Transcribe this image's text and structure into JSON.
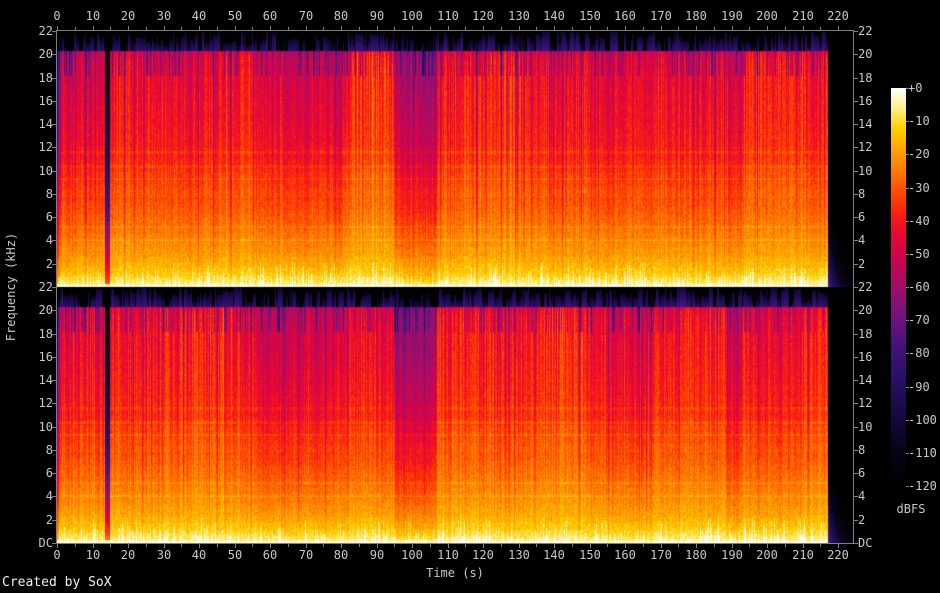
{
  "credit": "Created by SoX",
  "colors": {
    "background": "#000000",
    "label_text": "#c8c8c8",
    "credit_text": "#f0f0f0",
    "axis_line": "#808080"
  },
  "axes": {
    "time": {
      "label": "Time (s)",
      "tick_values": [
        0,
        10,
        20,
        30,
        40,
        50,
        60,
        70,
        80,
        90,
        100,
        110,
        120,
        130,
        140,
        150,
        160,
        170,
        180,
        190,
        200,
        210,
        220
      ],
      "tick_labels": [
        "0",
        "10",
        "20",
        "30",
        "40",
        "50",
        "60",
        "70",
        "80",
        "90",
        "100",
        "110",
        "120",
        "130",
        "140",
        "150",
        "160",
        "170",
        "180",
        "190",
        "200",
        "210",
        "220"
      ]
    },
    "frequency": {
      "label": "Frequency (kHz)",
      "tick_values": [
        22,
        20,
        18,
        16,
        14,
        12,
        10,
        8,
        6,
        4,
        2
      ],
      "tick_labels": [
        "22",
        "20",
        "18",
        "16",
        "14",
        "12",
        "10",
        "8",
        "6",
        "4",
        "2"
      ],
      "dc_label": "DC"
    }
  },
  "colorbar": {
    "unit_label": "dBFS",
    "tick_labels": [
      "+0",
      "-10",
      "-20",
      "-30",
      "-40",
      "-50",
      "-60",
      "-70",
      "-80",
      "-90",
      "-100",
      "-110",
      "-120"
    ]
  },
  "chart_data": {
    "type": "heatmap",
    "subtype": "audio-spectrogram",
    "title": "",
    "xlabel": "Time (s)",
    "ylabel": "Frequency (kHz)",
    "zlabel": "dBFS",
    "channels": 2,
    "x_range_s": [
      0,
      224.3
    ],
    "y_range_khz": [
      0,
      22
    ],
    "z_range_dbfs": [
      -120,
      0
    ],
    "audio_end_s": 217,
    "lowpass_cutoff_khz": 20.35,
    "silence_gap_s": [
      13.4,
      14.7
    ],
    "loudness_sections": [
      {
        "t0": 0,
        "t1": 13.4,
        "level": 0.94
      },
      {
        "t0": 13.4,
        "t1": 14.7,
        "level": 0.22
      },
      {
        "t0": 14.7,
        "t1": 56,
        "level": 1.0
      },
      {
        "t0": 56,
        "t1": 82,
        "level": 0.93
      },
      {
        "t0": 82,
        "t1": 95,
        "level": 1.01
      },
      {
        "t0": 95,
        "t1": 107,
        "level": 0.8
      },
      {
        "t0": 107,
        "t1": 150,
        "level": 1.0
      },
      {
        "t0": 150,
        "t1": 168,
        "level": 0.94
      },
      {
        "t0": 168,
        "t1": 189,
        "level": 1.01
      },
      {
        "t0": 189,
        "t1": 193,
        "level": 0.91
      },
      {
        "t0": 193,
        "t1": 217,
        "level": 1.01
      },
      {
        "t0": 217,
        "t1": 224.3,
        "level": 0.0
      }
    ],
    "spectral_envelope": [
      [
        0,
        0.98
      ],
      [
        0.3,
        0.95
      ],
      [
        0.8,
        0.915
      ],
      [
        1.5,
        0.885
      ],
      [
        2.5,
        0.852
      ],
      [
        4,
        0.818
      ],
      [
        5.5,
        0.79
      ],
      [
        7,
        0.762
      ],
      [
        9,
        0.728
      ],
      [
        11,
        0.702
      ],
      [
        13,
        0.685
      ],
      [
        15,
        0.672
      ],
      [
        17,
        0.662
      ],
      [
        18.5,
        0.652
      ],
      [
        19.5,
        0.64
      ],
      [
        20.2,
        0.62
      ],
      [
        20.45,
        0.38
      ],
      [
        21,
        0.32
      ],
      [
        22,
        0.26
      ]
    ],
    "harmonic_lines_khz": [
      4.1,
      5.2,
      9.3,
      10.4,
      11.6
    ],
    "palette_stops": [
      [
        0.0,
        "#000000"
      ],
      [
        0.09,
        "#0a0418"
      ],
      [
        0.18,
        "#180a44"
      ],
      [
        0.27,
        "#2a1066"
      ],
      [
        0.35,
        "#46127a"
      ],
      [
        0.42,
        "#6e147e"
      ],
      [
        0.5,
        "#a00f6a"
      ],
      [
        0.57,
        "#cc0550"
      ],
      [
        0.63,
        "#e80834"
      ],
      [
        0.68,
        "#fa1c14"
      ],
      [
        0.73,
        "#ff4600"
      ],
      [
        0.79,
        "#ff7800"
      ],
      [
        0.85,
        "#ffa800"
      ],
      [
        0.9,
        "#ffd200"
      ],
      [
        0.95,
        "#fff08c"
      ],
      [
        1.0,
        "#ffffff"
      ]
    ]
  }
}
